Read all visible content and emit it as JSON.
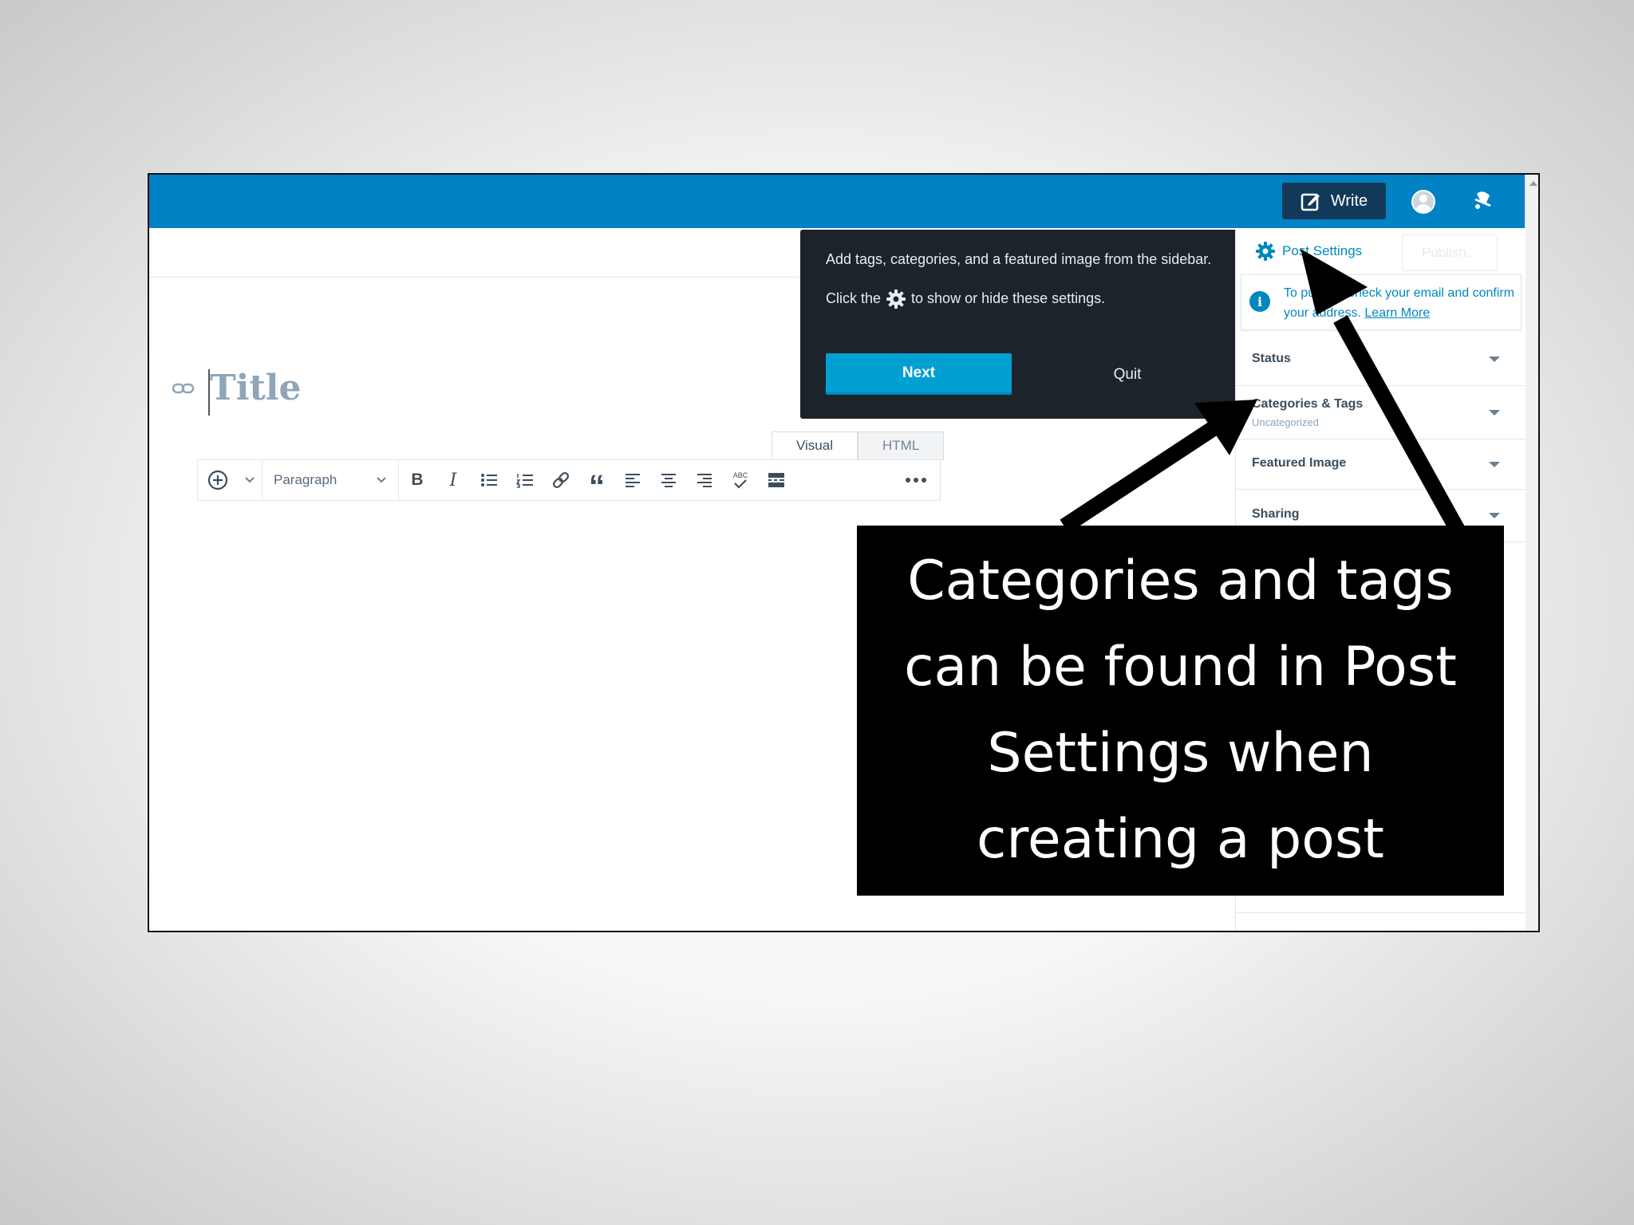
{
  "masterbar": {
    "write_label": "Write",
    "accent_color": "#0082c4",
    "icons": [
      "write-icon",
      "avatar",
      "notifications-icon"
    ]
  },
  "editor": {
    "title_placeholder": "Title",
    "mode_tabs": [
      "Visual",
      "HTML"
    ],
    "active_mode": "Visual",
    "block_format": "Paragraph",
    "toolbar_icons": [
      "add-block-icon",
      "chevron-down-icon",
      "bold-icon",
      "italic-icon",
      "bullet-list-icon",
      "numbered-list-icon",
      "link-icon",
      "blockquote-icon",
      "align-left-icon",
      "align-center-icon",
      "align-right-icon",
      "spellcheck-icon",
      "read-more-icon",
      "more-options-icon"
    ],
    "bold_glyph": "B",
    "italic_glyph": "I",
    "spellcheck_glyph": "ABC",
    "blockquote_glyph": "“"
  },
  "popover": {
    "line1": "Add tags, categories, and a featured image from the sidebar.",
    "line2_before": "Click the",
    "line2_after": "to show or hide these settings.",
    "next_label": "Next",
    "quit_label": "Quit"
  },
  "sidebar": {
    "post_settings_label": "Post Settings",
    "publish_label": "Publish...",
    "notice_text": "To publish, check your email and confirm your address.",
    "notice_link": "Learn More",
    "notice_icon": "i",
    "panels": [
      {
        "title": "Status",
        "sub": ""
      },
      {
        "title": "Categories & Tags",
        "sub": "Uncategorized"
      },
      {
        "title": "Featured Image",
        "sub": ""
      },
      {
        "title": "Sharing",
        "sub": ""
      }
    ]
  },
  "caption": {
    "text": "Categories and tags can be found in Post Settings when creating a post"
  }
}
